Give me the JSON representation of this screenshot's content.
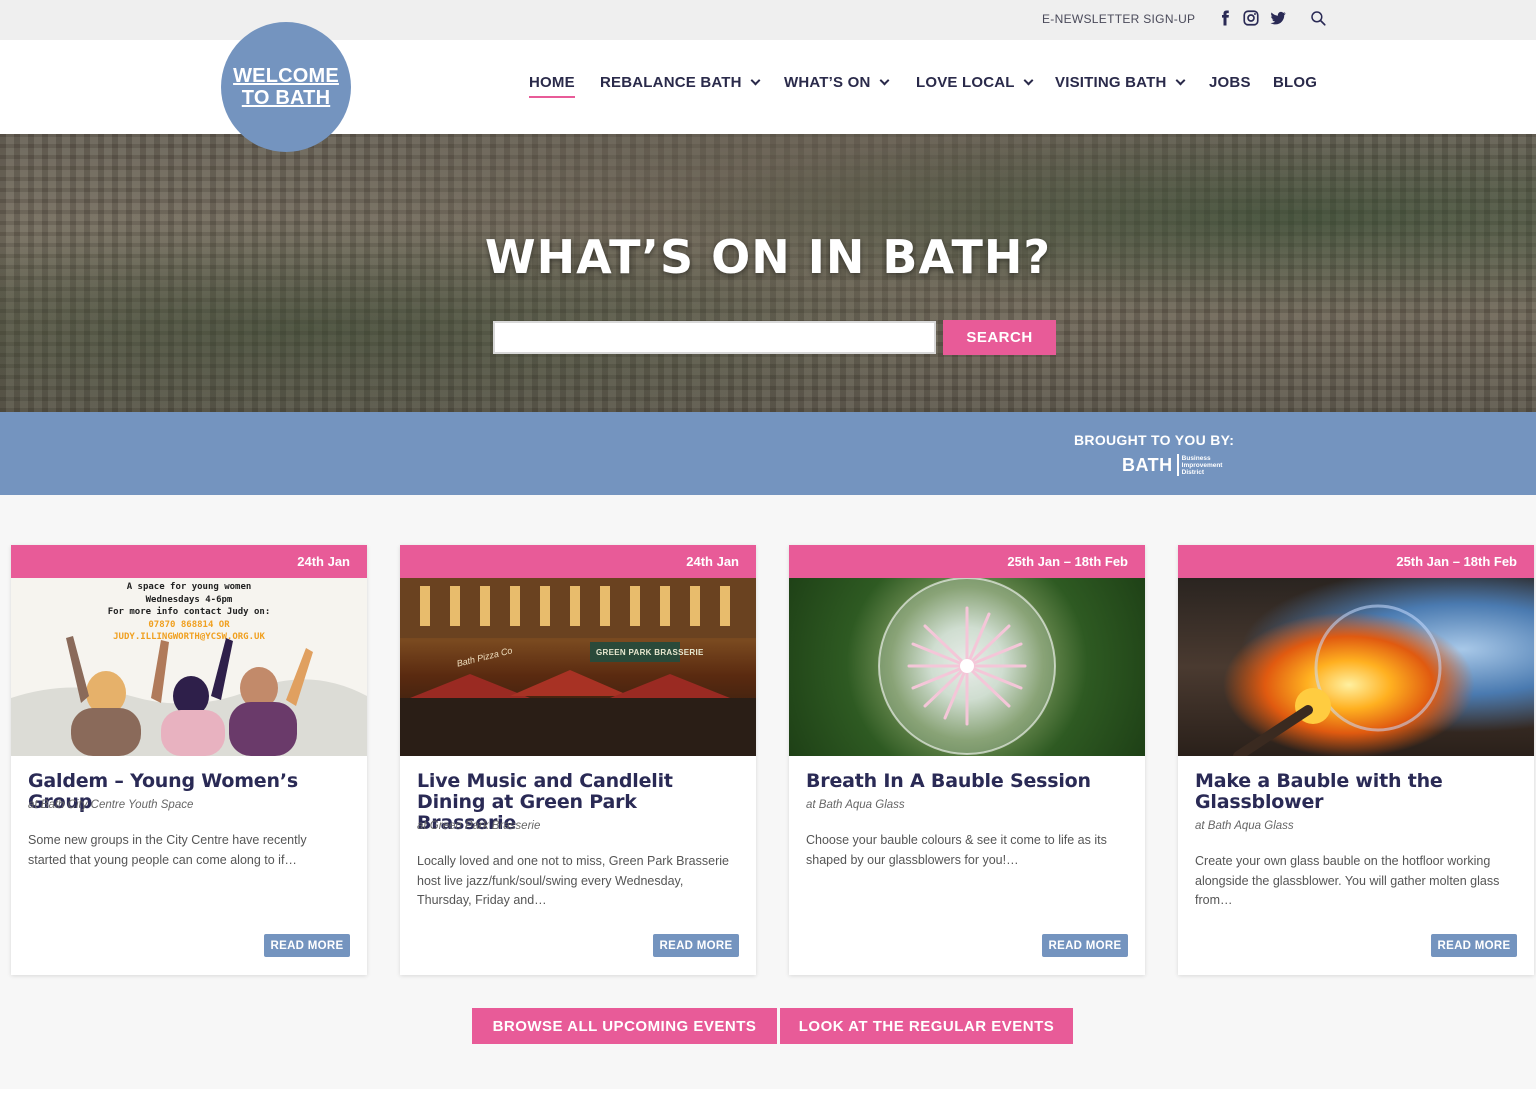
{
  "topbar": {
    "newsletter_label": "E-NEWSLETTER SIGN-UP",
    "icons": [
      "facebook-icon",
      "instagram-icon",
      "twitter-icon",
      "search-icon"
    ]
  },
  "header": {
    "logo_line1": "WELCOME",
    "logo_line2": "TO BATH",
    "nav": [
      {
        "label": "HOME",
        "dropdown": false,
        "active": true
      },
      {
        "label": "REBALANCE BATH",
        "dropdown": true
      },
      {
        "label": "WHAT’S ON",
        "dropdown": true
      },
      {
        "label": "LOVE LOCAL",
        "dropdown": true
      },
      {
        "label": "VISITING BATH",
        "dropdown": true
      },
      {
        "label": "JOBS",
        "dropdown": false
      },
      {
        "label": "BLOG",
        "dropdown": false
      }
    ]
  },
  "hero": {
    "title": "WHAT’S ON IN BATH?",
    "search_value": "",
    "search_button": "SEARCH"
  },
  "sponsor": {
    "label": "BROUGHT TO YOU BY:",
    "logo_main": "BATH",
    "logo_sub1": "Business",
    "logo_sub2": "Improvement",
    "logo_sub3": "District"
  },
  "events": [
    {
      "date": "24th Jan",
      "title": "Galdem – Young Women’s Group",
      "venue": "at Bath City Centre Youth Space",
      "description": "Some new groups in the City Centre have recently started that young people can come along to if…",
      "read_more": "READ MORE",
      "image_text": {
        "line1": "A space for young women",
        "line2": "Wednesdays 4-6pm",
        "line3": "For more info contact Judy on:",
        "line4": "07870 868814 OR",
        "line5": "JUDY.ILLINGWORTH@YCSW.ORG.UK"
      }
    },
    {
      "date": "24th Jan",
      "title": "Live Music and Candlelit Dining at Green Park Brasserie",
      "venue": "at Green Park Brasserie",
      "description": "Locally loved and one not to miss, Green Park Brasserie host live jazz/funk/soul/swing every Wednesday, Thursday, Friday and…",
      "read_more": "READ MORE",
      "image_text": {
        "sign": "GREEN PARK BRASSERIE",
        "sign2": "Bath Pizza Co"
      }
    },
    {
      "date": "25th Jan – 18th Feb",
      "title": "Breath In A Bauble Session",
      "venue": "at Bath Aqua Glass",
      "description": "Choose your bauble colours & see it come to life as its shaped by our glassblowers for you!…",
      "read_more": "READ MORE"
    },
    {
      "date": "25th Jan – 18th Feb",
      "title": "Make a Bauble with the Glassblower",
      "venue": "at Bath Aqua Glass",
      "description": "Create your own glass bauble on the hotfloor working alongside the glassblower. You will gather molten glass from…",
      "read_more": "READ MORE"
    }
  ],
  "cta": {
    "browse_all": "BROWSE ALL UPCOMING EVENTS",
    "regular": "LOOK AT THE REGULAR EVENTS"
  },
  "colors": {
    "accent_pink": "#e85b98",
    "brand_blue": "#7494bf",
    "text_navy": "#2a2a4a"
  }
}
